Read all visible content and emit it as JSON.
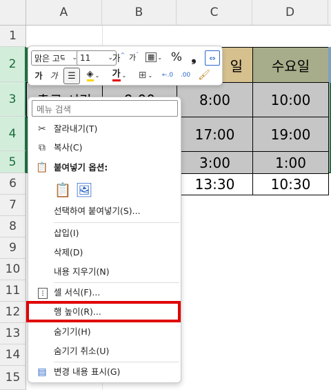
{
  "columns": [
    "A",
    "B",
    "C",
    "D"
  ],
  "rows": [
    "1",
    "2",
    "3",
    "4",
    "5",
    "6",
    "7",
    "8",
    "9",
    "10",
    "11",
    "12",
    "13",
    "14",
    "15"
  ],
  "cells": {
    "c2": "일",
    "d2": "수요일",
    "a3": "출근 시간",
    "b3": "9:00",
    "c3": "8:00",
    "d3": "10:00",
    "c4": "17:00",
    "d4": "19:00",
    "c5": "3:00",
    "d5": "1:00",
    "c6": "13:30",
    "d6": "10:30"
  },
  "toolbar": {
    "font_name": "맑은 고딕",
    "font_size": "11",
    "grow_font": "가",
    "shrink_font": "가",
    "percent": "%",
    "comma": "❟",
    "bold": "가",
    "italic": "가",
    "font_color_glyph": "가",
    "inc_decimal": "←.0",
    "dec_decimal": ".00",
    "accent_fill": "#ffd400",
    "accent_font": "#e00000"
  },
  "menu": {
    "search_placeholder": "메뉴 검색",
    "cut": "잘라내기(T)",
    "copy": "복사(C)",
    "paste_options": "붙여넣기 옵션:",
    "paste_special": "선택하여 붙여넣기(S)...",
    "insert": "삽입(I)",
    "delete": "삭제(D)",
    "clear": "내용 지우기(N)",
    "format_cells": "셀 서식(F)...",
    "row_height": "행 높이(R)...",
    "hide": "숨기기(H)",
    "unhide": "숨기기 취소(U)",
    "show_changes": "변경 내용 표시(G)"
  }
}
